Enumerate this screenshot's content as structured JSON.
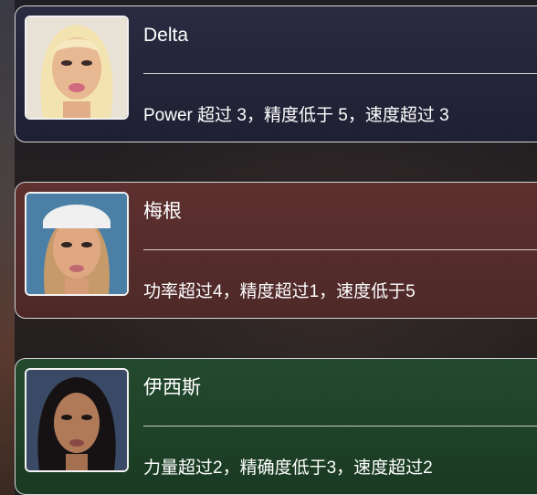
{
  "cards": [
    {
      "name": "Delta",
      "description": "Power 超过 3，精度低于 5，速度超过 3"
    },
    {
      "name": "梅根",
      "description": "功率超过4，精度超过1，速度低于5"
    },
    {
      "name": "伊西斯",
      "description": "力量超过2，精确度低于3，速度超过2"
    }
  ],
  "colors": {
    "card_1": "#24243a",
    "card_2": "#562c2c",
    "card_3": "#1f422a",
    "border": "#d6d6d6",
    "text": "#ffffff"
  }
}
